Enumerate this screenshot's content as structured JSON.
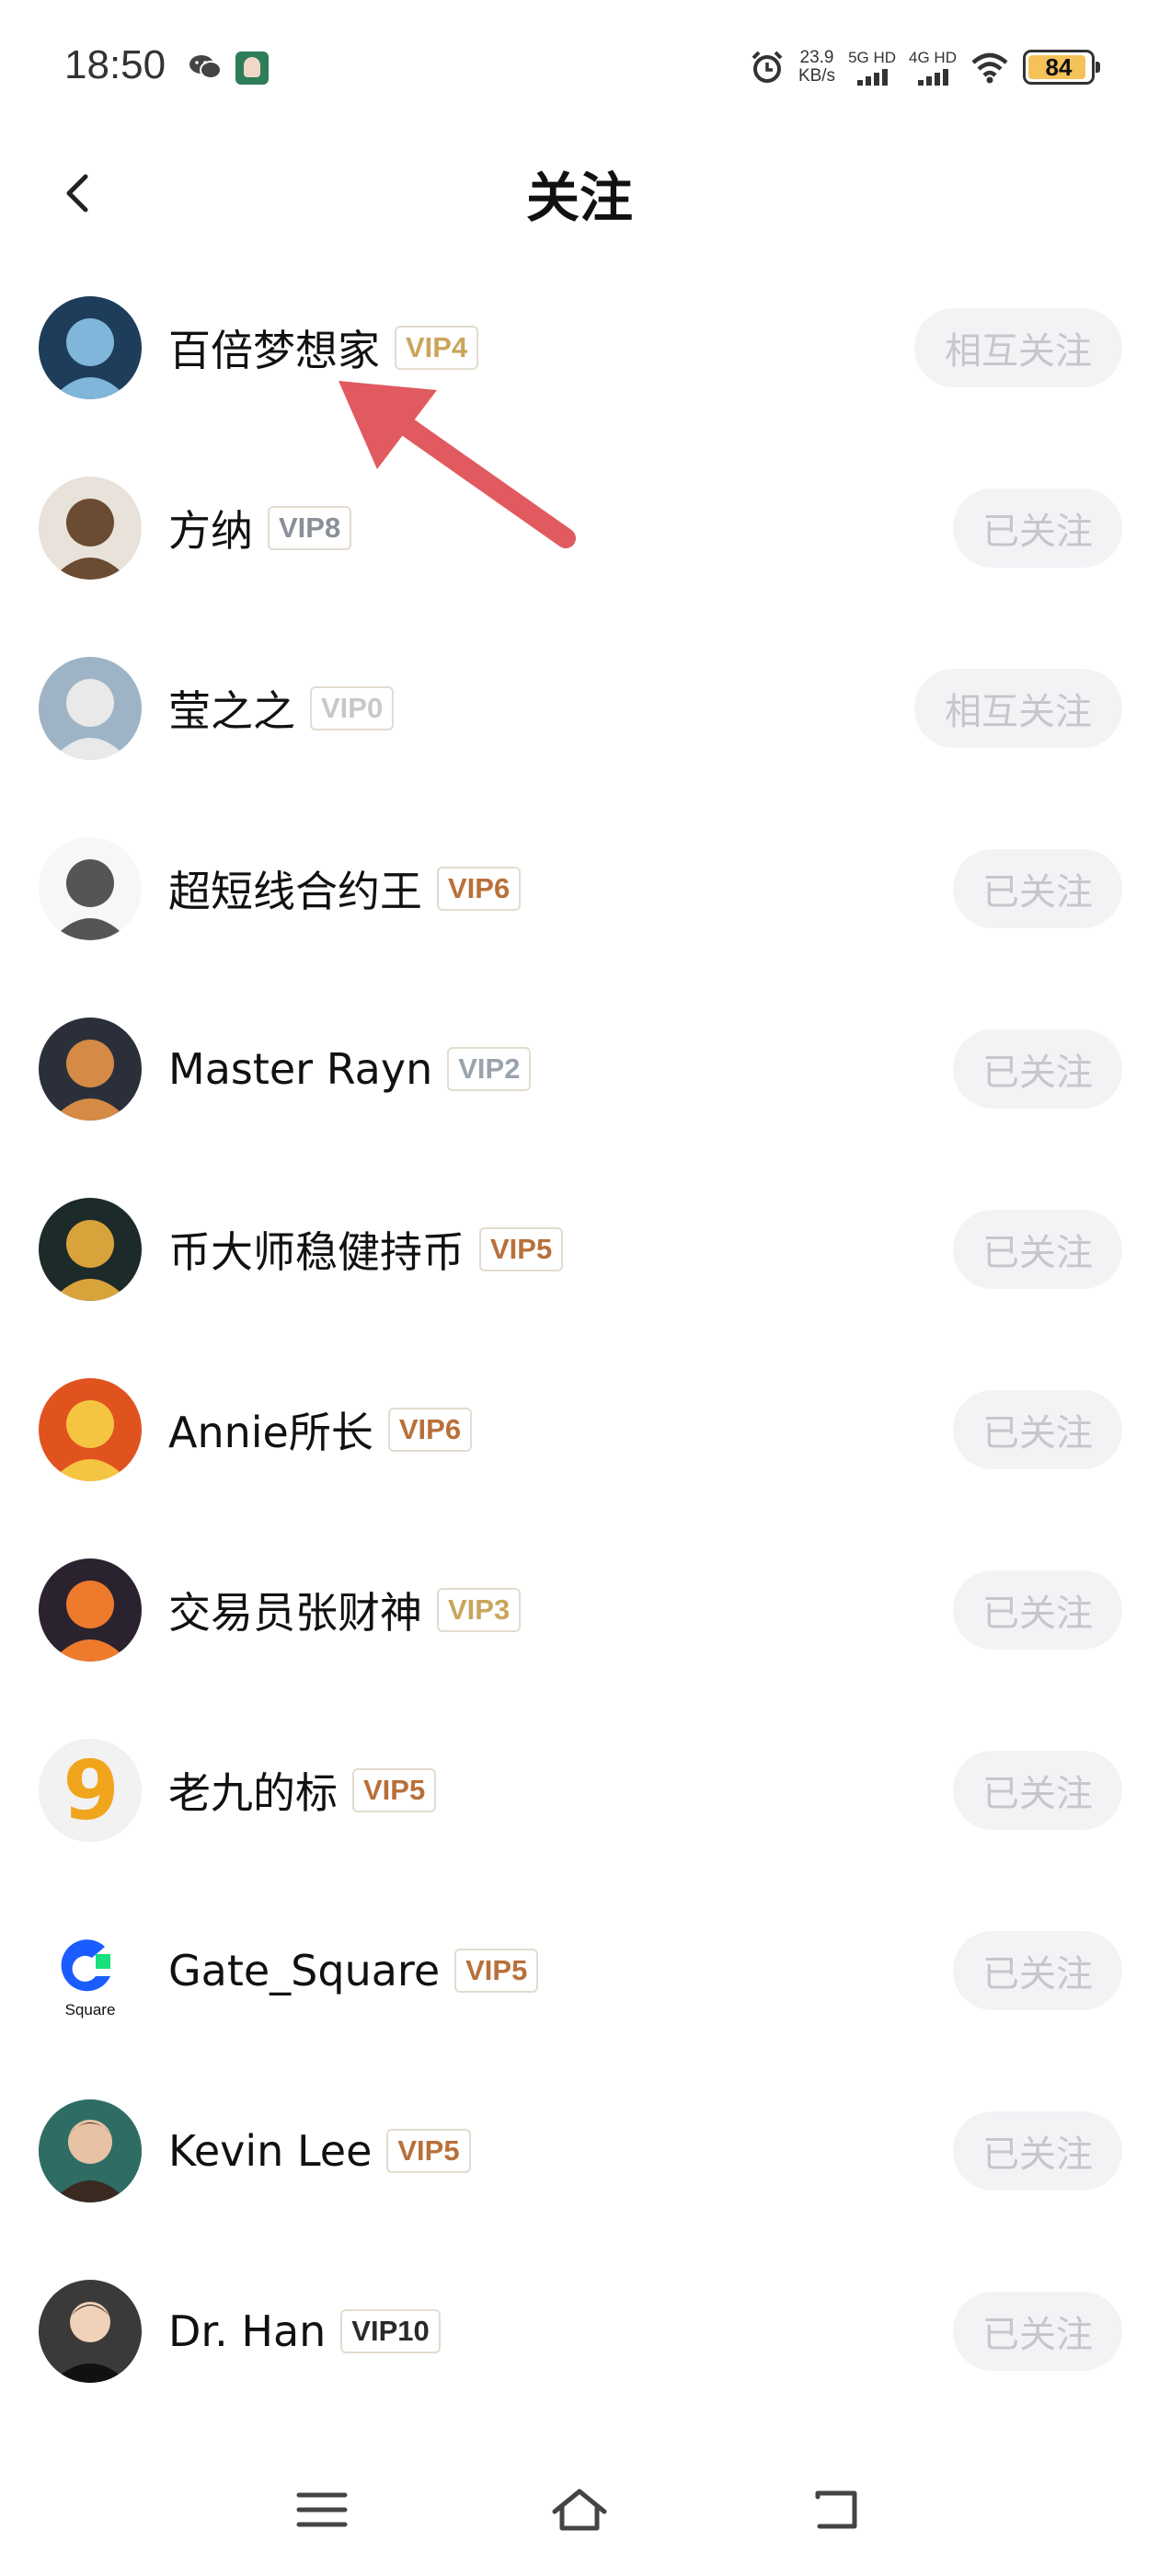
{
  "status_bar": {
    "time": "18:50",
    "net_speed_value": "23.9",
    "net_speed_unit": "KB/s",
    "sim1_label": "5G HD",
    "sim2_label": "4G HD",
    "battery": "84"
  },
  "header": {
    "title": "关注"
  },
  "users": [
    {
      "name": "百倍梦想家",
      "vip": "VIP4",
      "vip_color": "#c9a55c",
      "button": "相互关注",
      "avatar_bg": "#1e3d5a",
      "avatar_fg": "#7fb6d9"
    },
    {
      "name": "方纳",
      "vip": "VIP8",
      "vip_color": "#8a8f98",
      "button": "已关注",
      "avatar_bg": "#e8e2da",
      "avatar_fg": "#6b4b32"
    },
    {
      "name": "莹之之",
      "vip": "VIP0",
      "vip_color": "#c8c8c8",
      "button": "相互关注",
      "avatar_bg": "#9eb4c6",
      "avatar_fg": "#e9e9e9"
    },
    {
      "name": "超短线合约王",
      "vip": "VIP6",
      "vip_color": "#b8703a",
      "button": "已关注",
      "avatar_bg": "#f7f7f7",
      "avatar_fg": "#555555"
    },
    {
      "name": "Master Rayn",
      "vip": "VIP2",
      "vip_color": "#9aa3ad",
      "button": "已关注",
      "avatar_bg": "#2a2f3a",
      "avatar_fg": "#d58a45"
    },
    {
      "name": "币大师稳健持币",
      "vip": "VIP5",
      "vip_color": "#b8703a",
      "button": "已关注",
      "avatar_bg": "#1d2a2a",
      "avatar_fg": "#d9a33b"
    },
    {
      "name": "Annie所长",
      "vip": "VIP6",
      "vip_color": "#b8703a",
      "button": "已关注",
      "avatar_bg": "#e0531f",
      "avatar_fg": "#f5c542"
    },
    {
      "name": "交易员张财神",
      "vip": "VIP3",
      "vip_color": "#c9a55c",
      "button": "已关注",
      "avatar_bg": "#2b2230",
      "avatar_fg": "#ee7b2b"
    },
    {
      "name": "老九的标",
      "vip": "VIP5",
      "vip_color": "#b8703a",
      "button": "已关注",
      "avatar_bg": "#f2f2f2",
      "avatar_fg": "#f0a51c"
    },
    {
      "name": "Gate_Square",
      "vip": "VIP5",
      "vip_color": "#b8703a",
      "button": "已关注",
      "avatar_bg": "#ffffff",
      "avatar_fg": "#1a5cff",
      "avatar_text": "Square"
    },
    {
      "name": "Kevin Lee",
      "vip": "VIP5",
      "vip_color": "#b8703a",
      "button": "已关注",
      "avatar_bg": "#2f6d64",
      "avatar_fg": "#3a2a22"
    },
    {
      "name": "Dr. Han",
      "vip": "VIP10",
      "vip_color": "#2a2a2a",
      "button": "已关注",
      "avatar_bg": "#3a3a3a",
      "avatar_fg": "#f0d2b8"
    }
  ],
  "colors": {
    "arrow": "#e05a5f",
    "button_bg": "#f2f3f5",
    "button_text": "#c6c7ca"
  },
  "nav": {
    "menu_icon": "menu-icon",
    "home_icon": "home-icon",
    "back_icon": "return-icon"
  }
}
